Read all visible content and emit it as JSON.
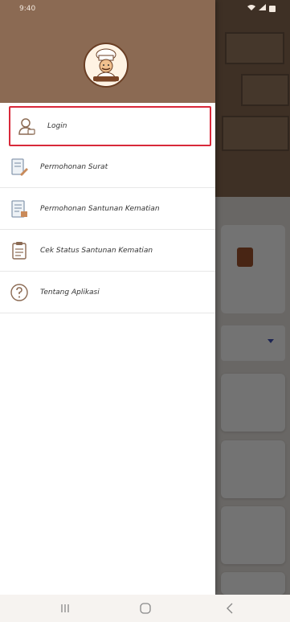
{
  "status_bar": {
    "time": "9:40"
  },
  "drawer": {
    "menu": [
      {
        "label": "Login",
        "icon": "user-icon",
        "selected": true
      },
      {
        "label": "Permohonan Surat",
        "icon": "document-edit-icon",
        "selected": false
      },
      {
        "label": "Permohonan Santunan Kematian",
        "icon": "document-list-icon",
        "selected": false
      },
      {
        "label": "Cek Status Santunan Kematian",
        "icon": "clipboard-icon",
        "selected": false
      },
      {
        "label": "Tentang Aplikasi",
        "icon": "help-icon",
        "selected": false
      }
    ]
  },
  "colors": {
    "header": "#8b6a53",
    "selected_border": "#d8293a",
    "drawer_bg": "#ffffff"
  }
}
